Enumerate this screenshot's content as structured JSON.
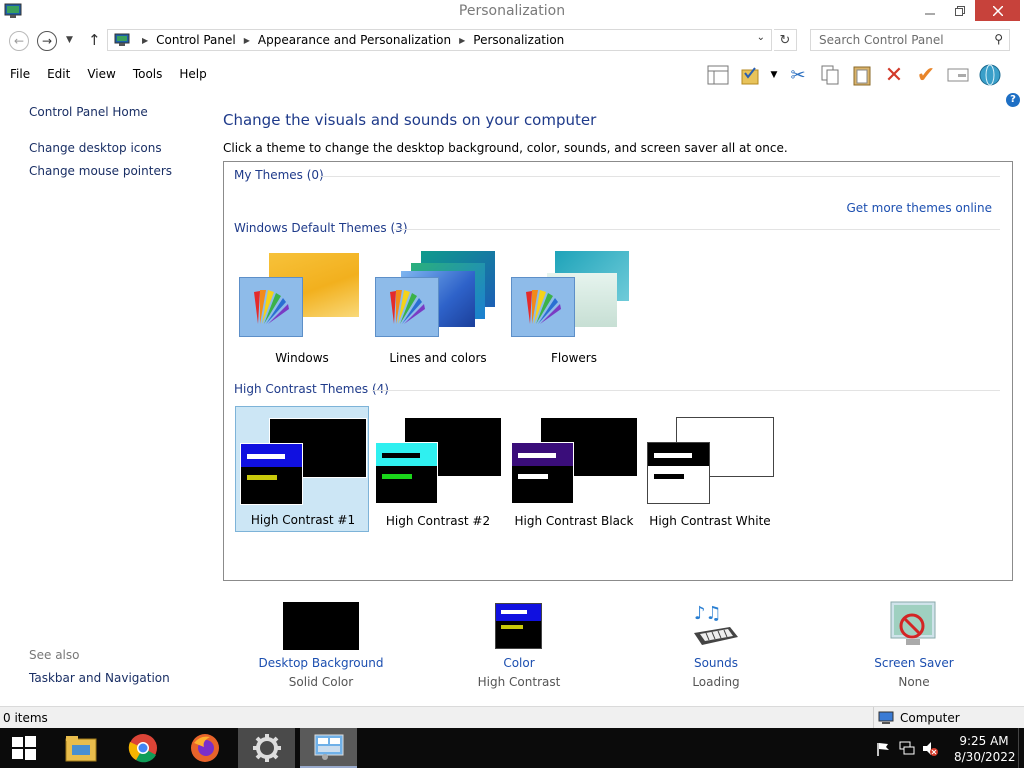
{
  "window": {
    "title": "Personalization"
  },
  "address": {
    "crumbs": [
      "Control Panel",
      "Appearance and Personalization",
      "Personalization"
    ],
    "search_placeholder": "Search Control Panel"
  },
  "menu": {
    "items": [
      "File",
      "Edit",
      "View",
      "Tools",
      "Help"
    ]
  },
  "left_pane": {
    "home": "Control Panel Home",
    "links": [
      "Change desktop icons",
      "Change mouse pointers"
    ],
    "see_also_label": "See also",
    "see_also_links": [
      "Taskbar and Navigation"
    ]
  },
  "main": {
    "heading": "Change the visuals and sounds on your computer",
    "subtext": "Click a theme to change the desktop background, color, sounds, and screen saver all at once.",
    "sections": {
      "my_themes": "My Themes (0)",
      "get_more": "Get more themes online",
      "default_themes": "Windows Default Themes (3)",
      "high_contrast": "High Contrast Themes (4)"
    },
    "default_themes": [
      "Windows",
      "Lines and colors",
      "Flowers"
    ],
    "high_contrast_themes": [
      "High Contrast #1",
      "High Contrast #2",
      "High Contrast Black",
      "High Contrast White"
    ],
    "selected_theme": "High Contrast #1"
  },
  "bottom": [
    {
      "title": "Desktop Background",
      "sub": "Solid Color"
    },
    {
      "title": "Color",
      "sub": "High Contrast"
    },
    {
      "title": "Sounds",
      "sub": "Loading"
    },
    {
      "title": "Screen Saver",
      "sub": "None"
    }
  ],
  "status": {
    "items": "0 items",
    "location": "Computer"
  },
  "taskbar": {
    "time": "9:25 AM",
    "date": "8/30/2022"
  },
  "colors": {
    "heading": "#1e3a8a",
    "link": "#1c4fb0",
    "selected_bg": "#cce6f5",
    "close_btn": "#c7423b"
  }
}
